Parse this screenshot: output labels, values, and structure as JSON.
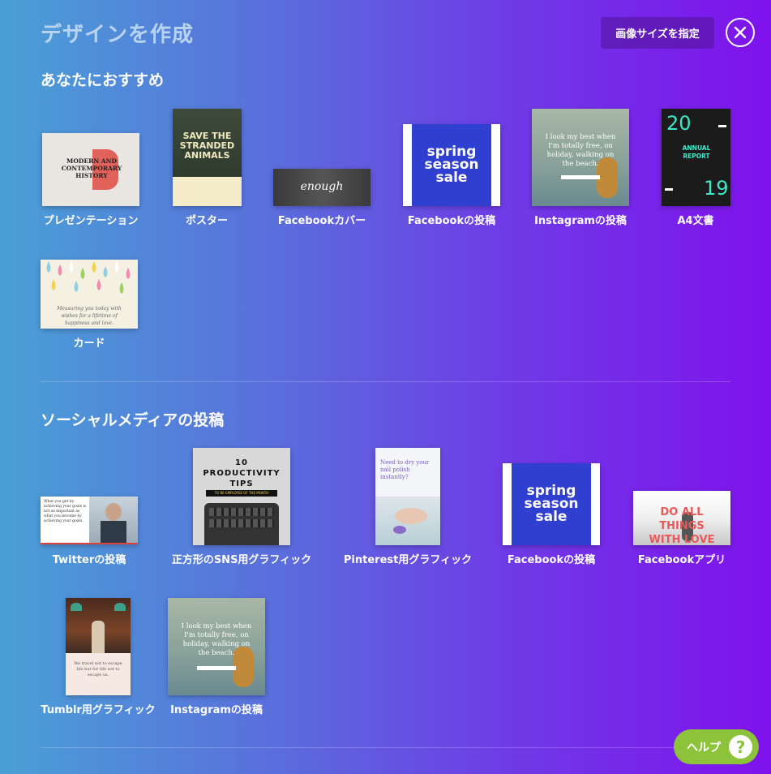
{
  "header": {
    "title": "デザインを作成",
    "custom_size_label": "画像サイズを指定"
  },
  "recommended": {
    "title": "あなたにおすすめ",
    "items": [
      {
        "label": "プレゼンテーション",
        "thumb_text": "MODERN AND CONTEMPORARY HISTORY"
      },
      {
        "label": "ポスター",
        "thumb_text": "SAVE THE STRANDED ANIMALS"
      },
      {
        "label": "Facebookカバー",
        "thumb_text": "enough"
      },
      {
        "label": "Facebookの投稿",
        "thumb_text": "spring season sale"
      },
      {
        "label": "Instagramの投稿",
        "thumb_text": "I look my best when I'm totally free, on holiday, walking on the beach."
      },
      {
        "label": "A4文書",
        "thumb_text_top": "20",
        "thumb_text_mid": "ANNUAL REPORT",
        "thumb_text_bottom": "19"
      },
      {
        "label": "カード",
        "thumb_text": "Measuring you today with wishes for a lifetime of happiness and love."
      }
    ]
  },
  "social": {
    "title": "ソーシャルメディアの投稿",
    "items": [
      {
        "label": "Twitterの投稿",
        "thumb_text": "What you get by achieving your goals is not as important as what you become by achieving your goals."
      },
      {
        "label": "正方形のSNS用グラフィック",
        "thumb_text": "10 PRODUCTIVITY TIPS",
        "thumb_sub": "TO BE EMPLOYEE OF THE MONTH"
      },
      {
        "label": "Pinterest用グラフィック",
        "thumb_text": "Need to dry your nail polish instantly?"
      },
      {
        "label": "Facebookの投稿",
        "thumb_text": "spring season sale"
      },
      {
        "label": "Facebookアプリ",
        "thumb_text": "DO ALL THINGS WITH LOVE"
      },
      {
        "label": "Tumblr用グラフィック",
        "thumb_text": "We travel not to escape life but for life not to escape us."
      },
      {
        "label": "Instagramの投稿",
        "thumb_text": "I look my best when I'm totally free, on holiday, walking on the beach."
      }
    ]
  },
  "help": {
    "label": "ヘルプ",
    "icon": "?"
  }
}
